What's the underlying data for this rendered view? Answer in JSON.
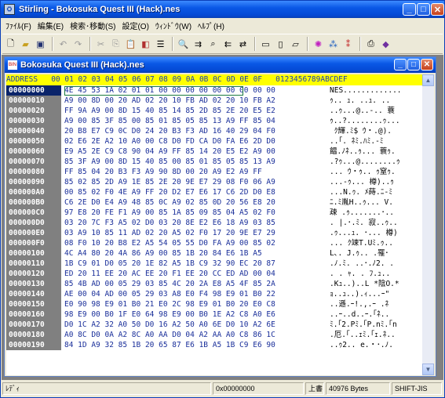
{
  "app": {
    "title": "Stirling - Bokosuka Quest III (Hack).nes"
  },
  "menu": [
    "ﾌｧｲﾙ(F)",
    "編集(E)",
    "検索･移動(S)",
    "設定(O)",
    "ｳｨﾝﾄﾞｳ(W)",
    "ﾍﾙﾌﾟ(H)"
  ],
  "child": {
    "title": "Bokosuka Quest III (Hack).nes"
  },
  "header": "ADDRESS   00 01 02 03 04 05 06 07 08 09 0A 0B 0C 0D 0E 0F   0123456789ABCDEF",
  "rows": [
    {
      "a": "00000000",
      "h": "4E 45 53 1A 02 01 01 00 00 00 00 00 00 00 00 00",
      "t": "NES............."
    },
    {
      "a": "00000010",
      "h": "A9 00 8D 00 20 AD 02 20 10 FB AD 02 20 10 FB A2",
      "t": "ｩ.. ｭ. ..ｭ. .."
    },
    {
      "a": "00000020",
      "h": "FF 9A A9 00 8D 15 40 85 14 85 2D 85 2E 20 E5 E2",
      "t": "..ｩ...@..-.. 蓑"
    },
    {
      "a": "00000030",
      "h": "A9 00 85 3F 85 00 85 01 85 05 85 13 A9 FF 85 04",
      "t": "ｩ..?........ｩ..."
    },
    {
      "a": "00000040",
      "h": "20 B8 E7 C9 0C D0 24 20 B3 F3 AD 16 40 29 04 F0",
      "t": " ｸ輝.ﾐ$ ｳ・.@)."
    },
    {
      "a": "00000050",
      "h": "02 E6 2E A2 10 A0 00 C8 D0 FD CA D0 FA E6 2D D0",
      "t": "..｢. ﾈﾐ.ﾊﾐ.-ﾐ"
    },
    {
      "a": "00000060",
      "h": "E9 A5 2E C9 C8 90 04 A9 FF 85 14 20 E5 E2 A9 00",
      "t": "饂.ﾉﾈ..ｩ... 蓑ｩ."
    },
    {
      "a": "00000070",
      "h": "85 3F A9 00 8D 15 40 85 00 85 01 85 05 85 13 A9",
      "t": ".?ｩ...@........ｩ"
    },
    {
      "a": "00000080",
      "h": "FF 85 04 20 B3 F3 A9 90 8D 00 20 A9 E2 A9 FF",
      "t": "... ｳ・ｩ.. ｩ窒ｩ."
    },
    {
      "a": "00000090",
      "h": "85 02 85 2D A9 1E 85 2E 20 9E E7 29 08 F0 06 A9",
      "t": "...-ｩ... 樽)..ｩ"
    },
    {
      "a": "000000A0",
      "h": "00 85 02 F0 4E A9 FF 20 D2 E7 E6 17 C6 2D D0 E8",
      "t": "...N.ｩ. ﾒ蒔.ﾆ-ﾐ"
    },
    {
      "a": "000000B0",
      "h": "C6 2E D0 E4 A9 48 85 0C A9 02 85 0D 20 56 E8 20",
      "t": "ﾆ.ﾐ胤H..ｩ... V. "
    },
    {
      "a": "000000C0",
      "h": "97 E8 20 FE F1 A9 00 85 1A 85 09 85 04 A5 02 F0",
      "t": "疎 .ｩ.......･.."
    },
    {
      "a": "000000D0",
      "h": "03 20 7C F3 A5 02 D0 03 20 8E E2 E6 18 A9 03 85",
      "t": ". |.･.ﾐ. 寂..ｩ.."
    },
    {
      "a": "000000E0",
      "h": "03 A9 10 85 11 AD 02 20 A5 02 F0 17 20 9E E7 29",
      "t": ".ｩ...ｭ. ･... 樽)"
    },
    {
      "a": "000000F0",
      "h": "08 F0 10 20 B8 E2 A5 54 05 55 D0 FA A9 00 85 02",
      "t": "... ｸ竦T.Uﾐ.ｩ.."
    },
    {
      "a": "00000100",
      "h": "4C A4 80 20 4A 86 A9 00 85 1B 20 84 E6 1B A5",
      "t": "L､. J.ｩ.. .罹･"
    },
    {
      "a": "00000110",
      "h": "1B C9 01 D0 05 20 1E 82 A5 1B C9 32 90 EC 20 87",
      "t": ".ﾉ.ﾐ. ..･.ﾉ2. ."
    },
    {
      "a": "00000120",
      "h": "ED 20 11 EE 20 AC EE 20 F1 EE 20 CC ED AD 00 04",
      "t": ". . ｬ. . ﾌ.ｭ.."
    },
    {
      "a": "00000130",
      "h": "85 4B AD 00 05 29 03 85 4C 20 2A E8 A5 4F 85 2A",
      "t": ".Kｭ..)..L *陰O.*"
    },
    {
      "a": "00000140",
      "h": "AE 00 04 AD 00 05 29 03 A8 E0 F4 98 E9 01 B0 22",
      "t": "ｮ..ｭ..).ｨ...ｰ\""
    },
    {
      "a": "00000150",
      "h": "E0 90 98 E9 01 B0 21 E0 2C 98 E9 01 B0 20 E0 C8",
      "t": "..遜.ｰ!.,.ｰ .ﾈ"
    },
    {
      "a": "00000160",
      "h": "98 E9 00 B0 1F E0 64 98 E9 00 B0 1E A2 C8 A0 E6",
      "t": "..ｰ..d..ｰ.｢ﾈ.."
    },
    {
      "a": "00000170",
      "h": "D0 1C A2 32 A0 50 D0 16 A2 50 A0 6E D0 10 A2 6E",
      "t": "ﾐ.｢2.Pﾐ.｢P.nﾐ.｢n"
    },
    {
      "a": "00000180",
      "h": "A0 8C D0 0A A2 8C A0 AA D0 04 A2 AA A0 C8 86 1C",
      "t": ".厄.｢..ｪﾐ.｢ｪ.ﾈ.."
    },
    {
      "a": "00000190",
      "h": "84 1D A9 32 85 1B 20 65 87 E6 1B A5 1B C9 E6 90",
      "t": "..ｩ2.. e.・･.ﾉ."
    }
  ],
  "status": {
    "mode": "ﾚﾃﾞｨ",
    "offset": "0x00000000",
    "overwrite": "上書",
    "size": "40976 Bytes",
    "encoding": "SHIFT-JIS"
  },
  "toolbar": [
    "new-icon",
    "open-icon",
    "save-icon",
    "undo-icon",
    "redo-icon",
    "cut-icon",
    "copy-icon",
    "paste-icon",
    "find-icon",
    "goto-icon"
  ]
}
